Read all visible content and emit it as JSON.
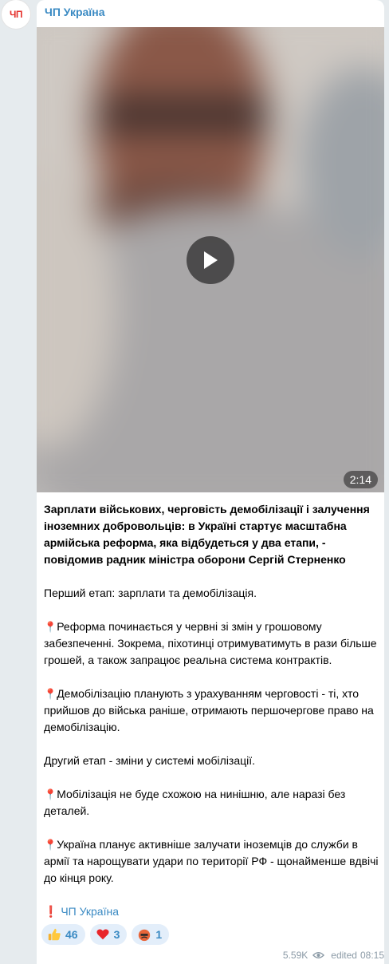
{
  "channel": {
    "name": "ЧП Україна",
    "avatar_text": "ЧП"
  },
  "video": {
    "duration": "2:14",
    "play_icon": "play-icon"
  },
  "post": {
    "headline": "Зарплати військових, черговість демобілізації і залучення іноземних добровольців: в Україні стартує масштабна армійська реформа, яка відбудеться у два етапи, - повідомив радник міністра оборони Сергій Стерненко",
    "stage1": "Перший етап: зарплати та демобілізація.",
    "item1": "Реформа починається у червні зі змін у грошовому забезпеченні. Зокрема, піхотинці отримуватимуть в рази більше грошей, а також запрацює реальна система контрактів.",
    "item2": "Демобілізацію планують з урахуванням черговості - ті, хто прийшов до війська раніше, отримають першочергове право на демобілізацію.",
    "stage2": "Другий етап - зміни у системі мобілізації.",
    "item3": "Мобілізація не буде схожою на нинішню, але наразі без деталей.",
    "item4": "Україна планує активніше залучати іноземців до служби в армії та нарощувати удари по території РФ - щонайменше вдвічі до кінця року.",
    "signoff": "ЧП Україна"
  },
  "reactions": [
    {
      "icon": "thumbs-up-icon",
      "count": "46"
    },
    {
      "icon": "heart-icon",
      "count": "3"
    },
    {
      "icon": "angry-face-icon",
      "count": "1"
    }
  ],
  "meta": {
    "views": "5.59K",
    "status": "edited",
    "time": "08:15"
  },
  "colors": {
    "link": "#3a8ac3",
    "reaction_bg": "#e3eefa",
    "accent_red": "#e5322d"
  }
}
